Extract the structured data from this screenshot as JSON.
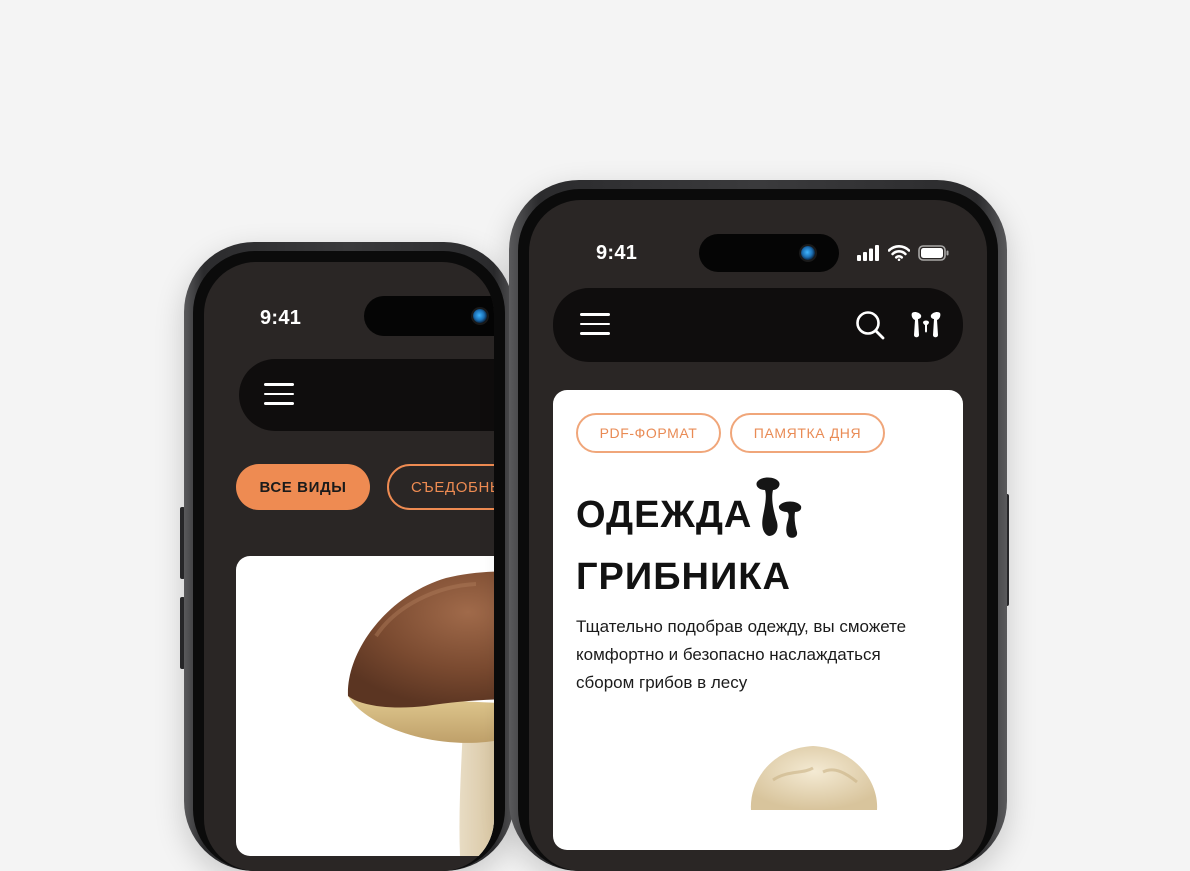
{
  "back_phone": {
    "status_time": "9:41",
    "chips": [
      "ВСЕ ВИДЫ",
      "СЪЕДОБНЫ"
    ],
    "icons": {
      "menu": "hamburger-menu-icon",
      "camera": "front-camera-icon"
    }
  },
  "front_phone": {
    "status_time": "9:41",
    "tags": [
      "PDF-ФОРМАТ",
      "ПАМЯТКА ДНЯ"
    ],
    "title_line1": "ОДЕЖДА",
    "title_line2": "ГРИБНИКА",
    "description_lines": [
      "Тщательно подобрав одежду, вы сможете",
      "комфортно и безопасно наслаждаться",
      "сбором грибов в лесу"
    ],
    "icons": {
      "menu": "hamburger-menu-icon",
      "search": "search-icon",
      "logo": "mushroom-logo-icon",
      "signal": "cellular-signal-icon",
      "wifi": "wifi-icon",
      "battery": "battery-icon",
      "title_mushroom": "mushroom-illustration-icon"
    }
  },
  "colors": {
    "accent": "#ee8b52",
    "screen_bg": "#2a2625",
    "navbar_bg": "#0f0d0d",
    "page_bg": "#f4f4f4"
  }
}
